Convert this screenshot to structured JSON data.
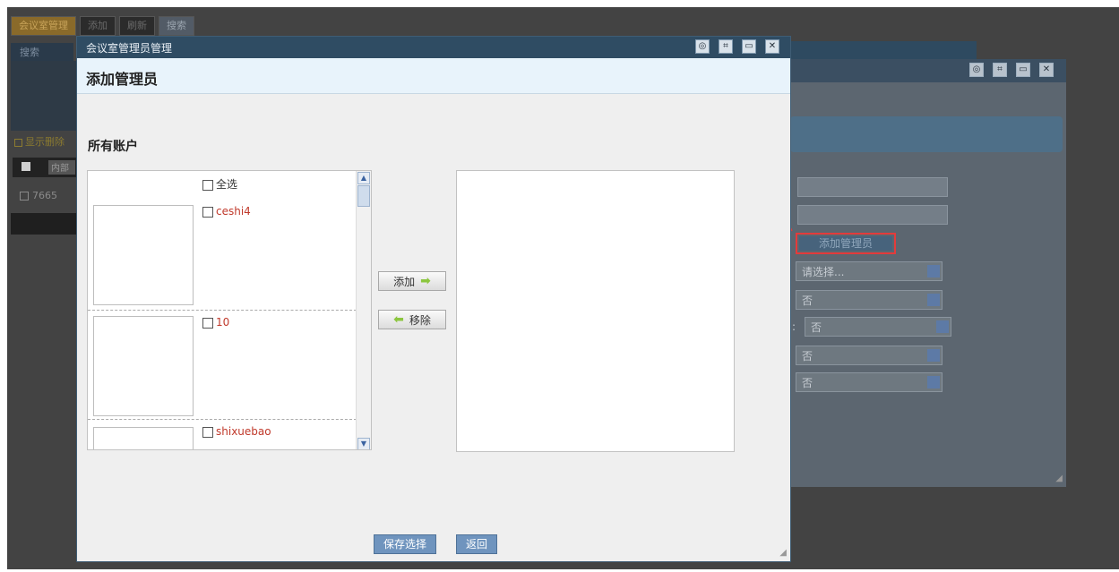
{
  "background": {
    "toolbar": [
      "会议室管理",
      "添加",
      "刷新",
      "搜索"
    ],
    "tab": "搜索",
    "checkbox_row": "显示删除",
    "row_label": "内部",
    "row_id": "7665",
    "selects": [
      "请选择...",
      "否",
      "否",
      "否",
      "否"
    ],
    "add_button": "添加管理员"
  },
  "dialog": {
    "window_title": "会议室管理员管理",
    "header": "添加管理员",
    "section_label": "所有账户",
    "select_all": "全选",
    "accounts": [
      "ceshi4",
      "10",
      "shixuebao"
    ],
    "add_label": "添加",
    "remove_label": "移除",
    "save_label": "保存选择",
    "back_label": "返回"
  }
}
